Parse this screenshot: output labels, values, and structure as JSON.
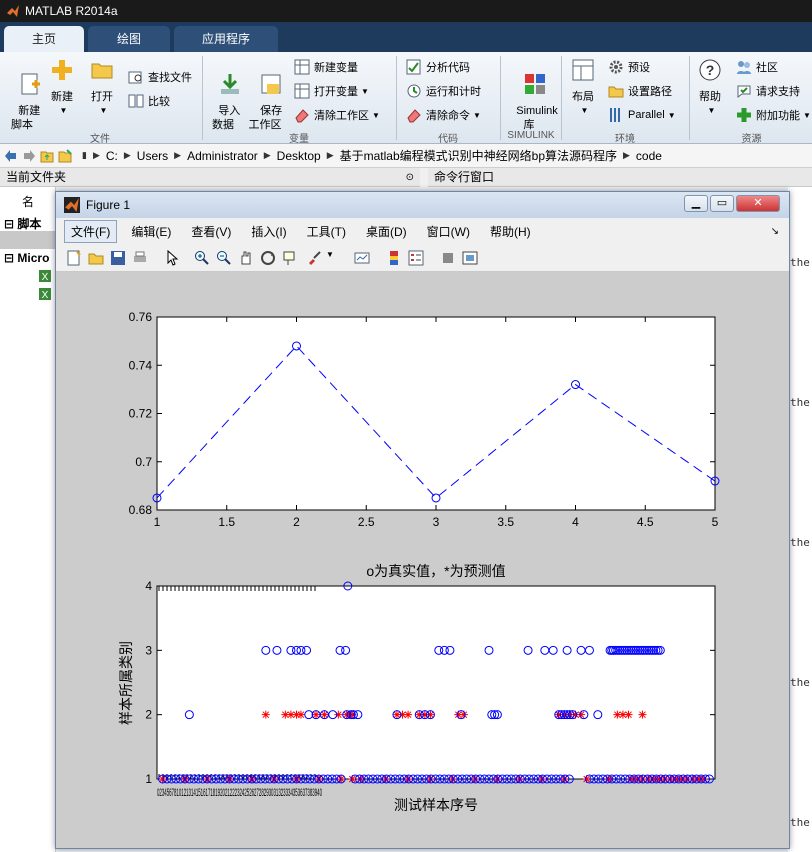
{
  "app": {
    "title": "MATLAB R2014a"
  },
  "tabs": [
    {
      "label": "主页",
      "active": true
    },
    {
      "label": "绘图",
      "active": false
    },
    {
      "label": "应用程序",
      "active": false
    }
  ],
  "ribbon": {
    "file": {
      "new_script": "新建\n脚本",
      "new": "新建",
      "open": "打开",
      "find_files": "查找文件",
      "compare": "比较",
      "group": "文件"
    },
    "variable": {
      "import": "导入\n数据",
      "save_ws": "保存\n工作区",
      "new_var": "新建变量",
      "open_var": "打开变量",
      "clear_ws": "清除工作区",
      "group": "变量"
    },
    "code": {
      "analyze": "分析代码",
      "run_time": "运行和计时",
      "clear_cmd": "清除命令",
      "group": "代码"
    },
    "simulink": {
      "label": "Simulink\n库",
      "group": "SIMULINK"
    },
    "env": {
      "layout": "布局",
      "prefs": "预设",
      "set_path": "设置路径",
      "parallel": "Parallel",
      "group": "环境"
    },
    "resources": {
      "help": "帮助",
      "community": "社区",
      "support": "请求支持",
      "addons": "附加功能",
      "group": "资源"
    }
  },
  "path": [
    "C:",
    "Users",
    "Administrator",
    "Desktop",
    "基于matlab编程模式识别中神经网络bp算法源码程序",
    "code"
  ],
  "panels": {
    "current_folder": "当前文件夹",
    "command_window": "命令行窗口",
    "name_col": "名",
    "scripts": "脚本",
    "micro": "Micro"
  },
  "cmd_lines": [
    "the",
    "the",
    "the",
    "the",
    "the",
    "the",
    "the"
  ],
  "figure": {
    "title": "Figure 1",
    "menu": [
      "文件(F)",
      "编辑(E)",
      "查看(V)",
      "插入(I)",
      "工具(T)",
      "桌面(D)",
      "窗口(W)",
      "帮助(H)"
    ]
  },
  "chart_data": [
    {
      "type": "line",
      "x": [
        1,
        2,
        3,
        4,
        5
      ],
      "y": [
        0.685,
        0.748,
        0.685,
        0.732,
        0.692
      ],
      "xlim": [
        1,
        5
      ],
      "ylim": [
        0.68,
        0.76
      ],
      "xticks": [
        "1",
        "1.5",
        "2",
        "2.5",
        "3",
        "3.5",
        "4",
        "4.5",
        "5"
      ],
      "yticks": [
        "0.68",
        "0.7",
        "0.72",
        "0.74",
        "0.76"
      ],
      "line_style": "dashed",
      "marker": "o",
      "color": "#0000ff",
      "grid": false
    },
    {
      "type": "scatter",
      "title": "o为真实值，*为预测值",
      "xlabel": "测试样本序号",
      "ylabel": "样本所属类别",
      "ylim": [
        1,
        4
      ],
      "yticks": [
        "1",
        "2",
        "3",
        "4"
      ],
      "xtick_text": "02345678101213141516171819202122232425262728293031323334353637383940",
      "true_color": "#0000ff",
      "pred_color": "#ff0000",
      "true_marker": "o",
      "pred_marker": "*",
      "true_values": {
        "class4": [
          0.342
        ],
        "class3": [
          0.195,
          0.215,
          0.24,
          0.25,
          0.258,
          0.268,
          0.328,
          0.338,
          0.505,
          0.515,
          0.525,
          0.595,
          0.665,
          0.695,
          0.71,
          0.735,
          0.76,
          0.775,
          0.812,
          0.815,
          0.818,
          0.822,
          0.826,
          0.83,
          0.834,
          0.838,
          0.842,
          0.846,
          0.85,
          0.854,
          0.858,
          0.862,
          0.866,
          0.87,
          0.874,
          0.878,
          0.882,
          0.886,
          0.89,
          0.894,
          0.898,
          0.902
        ],
        "class2": [
          0.058,
          0.272,
          0.285,
          0.3,
          0.315,
          0.34,
          0.348,
          0.352,
          0.36,
          0.43,
          0.47,
          0.48,
          0.49,
          0.545,
          0.6,
          0.605,
          0.61,
          0.72,
          0.725,
          0.73,
          0.735,
          0.74,
          0.745,
          0.765,
          0.79
        ],
        "class1": [
          0.01,
          0.018,
          0.026,
          0.034,
          0.042,
          0.05,
          0.058,
          0.066,
          0.074,
          0.082,
          0.09,
          0.098,
          0.106,
          0.114,
          0.122,
          0.13,
          0.138,
          0.146,
          0.154,
          0.162,
          0.17,
          0.178,
          0.186,
          0.194,
          0.202,
          0.21,
          0.218,
          0.226,
          0.234,
          0.242,
          0.25,
          0.258,
          0.266,
          0.274,
          0.282,
          0.29,
          0.298,
          0.306,
          0.314,
          0.322,
          0.33,
          0.355,
          0.363,
          0.371,
          0.379,
          0.387,
          0.395,
          0.403,
          0.411,
          0.419,
          0.427,
          0.435,
          0.443,
          0.451,
          0.459,
          0.467,
          0.475,
          0.483,
          0.491,
          0.499,
          0.507,
          0.515,
          0.523,
          0.531,
          0.539,
          0.547,
          0.555,
          0.563,
          0.571,
          0.579,
          0.587,
          0.595,
          0.603,
          0.611,
          0.619,
          0.627,
          0.635,
          0.643,
          0.651,
          0.659,
          0.667,
          0.675,
          0.683,
          0.691,
          0.699,
          0.707,
          0.715,
          0.723,
          0.731,
          0.739,
          0.775,
          0.783,
          0.791,
          0.799,
          0.807,
          0.815,
          0.823,
          0.831,
          0.839,
          0.847,
          0.855,
          0.863,
          0.871,
          0.879,
          0.887,
          0.895,
          0.903,
          0.911,
          0.919,
          0.927,
          0.935,
          0.943,
          0.951,
          0.959,
          0.967,
          0.975,
          0.983,
          0.99
        ]
      },
      "pred_values": {
        "class2": [
          0.195,
          0.23,
          0.24,
          0.25,
          0.258,
          0.285,
          0.3,
          0.325,
          0.34,
          0.345,
          0.35,
          0.43,
          0.44,
          0.45,
          0.47,
          0.48,
          0.49,
          0.54,
          0.55,
          0.72,
          0.73,
          0.74,
          0.75,
          0.76,
          0.825,
          0.835,
          0.845,
          0.87
        ],
        "class1": [
          0.01,
          0.05,
          0.09,
          0.13,
          0.17,
          0.21,
          0.25,
          0.29,
          0.33,
          0.35,
          0.365,
          0.41,
          0.45,
          0.49,
          0.53,
          0.57,
          0.61,
          0.65,
          0.69,
          0.73,
          0.77,
          0.81,
          0.85,
          0.86,
          0.87,
          0.88,
          0.89,
          0.9,
          0.91,
          0.92,
          0.93,
          0.94,
          0.95,
          0.96,
          0.97,
          0.98
        ]
      }
    }
  ]
}
